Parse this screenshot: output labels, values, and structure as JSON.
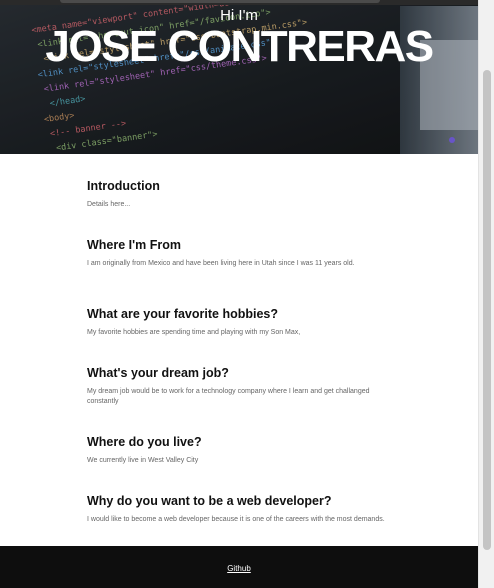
{
  "hero": {
    "greeting": "Hi I'm",
    "name": "JOSE CONTRERAS",
    "code_lines": [
      "<meta name=\"viewport\" content=\"width=device-width",
      "<link rel=\"shortcut icon\" href=\"/favicon.ico\">",
      "<link rel=\"stylesheet\" href=\"css/bootstrap.min.css\">",
      "<link rel=\"stylesheet\" href=\"/css/animate.css\">",
      "<link rel=\"stylesheet\" href=\"css/theme.css\">",
      "</head>",
      "<body>",
      "<!-- banner -->",
      "<div class=\"banner\">"
    ]
  },
  "sections": [
    {
      "title": "Introduction",
      "body": "Details here..."
    },
    {
      "title": "Where I'm From",
      "body": "I am originally from Mexico and have been living here in Utah since I was 11 years old."
    },
    {
      "title": "What are your favorite hobbies?",
      "body": "My favorite hobbies are spending time and playing with my Son Max,"
    },
    {
      "title": "What's your dream job?",
      "body": "My dream job would be to work for a technology company where I learn and get challanged constantly"
    },
    {
      "title": "Where do you live?",
      "body": "We currently live in West Valley City"
    },
    {
      "title": "Why do you want to be a web developer?",
      "body": "I would like to become a web developer because it is one of the careers with the most demands."
    }
  ],
  "footer": {
    "link_label": "Github"
  },
  "colors": {
    "footer_bg": "#0e0e0e",
    "heading": "#111111",
    "body_text": "#666666"
  }
}
